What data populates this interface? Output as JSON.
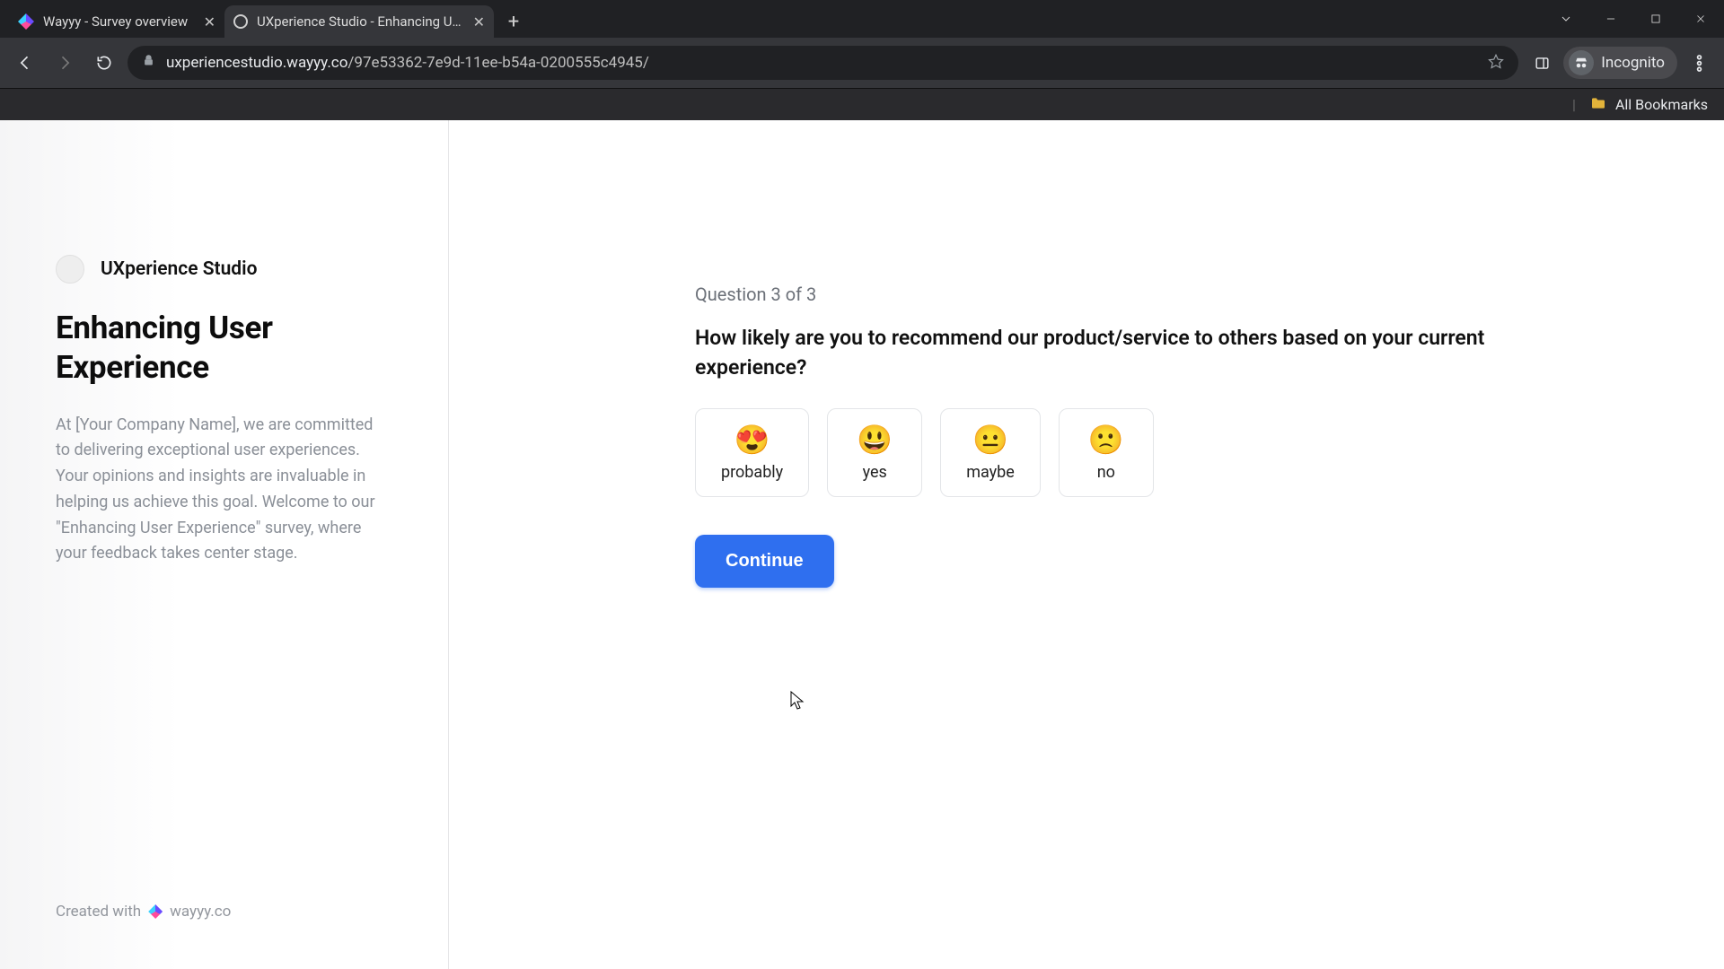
{
  "browser": {
    "tabs": [
      {
        "title": "Wayyy - Survey overview",
        "favicon": "wayyy",
        "active": false
      },
      {
        "title": "UXperience Studio - Enhancing User Experience",
        "favicon": "studio",
        "active": true
      }
    ],
    "url_host": "uxperiencestudio.wayyy.co",
    "url_path": "/97e53362-7e9d-11ee-b54a-0200555c4945/",
    "incognito_label": "Incognito",
    "bookmarks_label": "All Bookmarks"
  },
  "sidebar": {
    "studio_name": "UXperience Studio",
    "title": "Enhancing User Experience",
    "description": "At [Your Company Name], we are committed to delivering exceptional user experiences. Your opinions and insights are invaluable in helping us achieve this goal. Welcome to our \"Enhancing User Experience\" survey, where your feedback takes center stage.",
    "credit_prefix": "Created with",
    "credit_brand": "wayyy.co"
  },
  "question": {
    "counter": "Question 3 of 3",
    "text": "How likely are you to recommend our product/service to others based on your current experience?",
    "options": [
      {
        "emoji": "😍",
        "label": "probably"
      },
      {
        "emoji": "😃",
        "label": "yes"
      },
      {
        "emoji": "😐",
        "label": "maybe"
      },
      {
        "emoji": "🙁",
        "label": "no"
      }
    ],
    "continue_label": "Continue"
  },
  "colors": {
    "accent": "#2f6fef",
    "progress": "#1a73e8"
  }
}
